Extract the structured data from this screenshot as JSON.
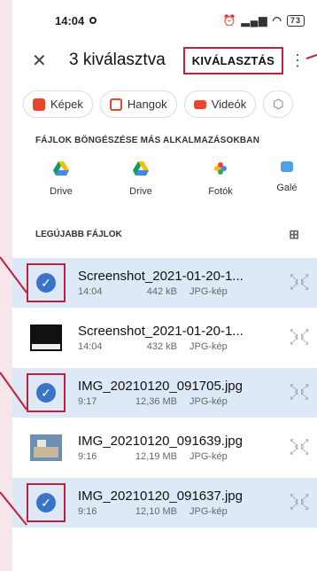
{
  "status": {
    "time": "14:04",
    "battery": "73"
  },
  "topbar": {
    "close_icon": "close-icon",
    "title": "3 kiválasztva",
    "select_label": "KIVÁLASZTÁS",
    "more_icon": "more-vertical-icon"
  },
  "chips": [
    {
      "label": "Képek",
      "color": "#e8462f"
    },
    {
      "label": "Hangok",
      "color": "#e8462f"
    },
    {
      "label": "Videók",
      "color": "#e8462f"
    },
    {
      "label": "",
      "color": "#666666"
    }
  ],
  "browse": {
    "heading": "FÁJLOK BÖNGÉSZÉSE MÁS ALKALMAZÁSOKBAN",
    "apps": [
      {
        "label": "Drive"
      },
      {
        "label": "Drive"
      },
      {
        "label": "Fotók"
      },
      {
        "label": "Galé"
      }
    ]
  },
  "recent": {
    "heading": "LEGÚJABB FÁJLOK",
    "files": [
      {
        "name": "Screenshot_2021-01-20-1...",
        "time": "14:04",
        "size": "442 kB",
        "kind": "JPG-kép",
        "selected": true
      },
      {
        "name": "Screenshot_2021-01-20-1...",
        "time": "14:04",
        "size": "432 kB",
        "kind": "JPG-kép",
        "selected": false
      },
      {
        "name": "IMG_20210120_091705.jpg",
        "time": "9:17",
        "size": "12,36 MB",
        "kind": "JPG-kép",
        "selected": true
      },
      {
        "name": "IMG_20210120_091639.jpg",
        "time": "9:16",
        "size": "12,19 MB",
        "kind": "JPG-kép",
        "selected": false
      },
      {
        "name": "IMG_20210120_091637.jpg",
        "time": "9:16",
        "size": "12,10 MB",
        "kind": "JPG-kép",
        "selected": true
      }
    ]
  },
  "colors": {
    "accent": "#3a74c9",
    "highlight": "#c0213a",
    "selected_bg": "#dde9f7"
  }
}
